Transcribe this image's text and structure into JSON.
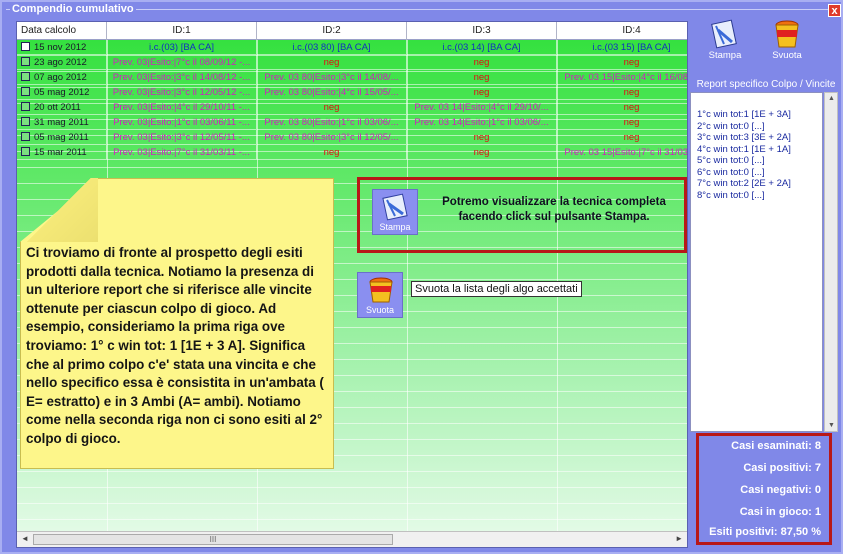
{
  "window": {
    "title": "Compendio cumulativo",
    "close_label": "x"
  },
  "grid": {
    "columns": [
      "Data calcolo",
      "ID:1",
      "ID:2",
      "ID:3",
      "ID:4"
    ],
    "rows": [
      {
        "date": "15 nov 2012",
        "selected": true,
        "cells": [
          {
            "text": "i.c.(03) [BA CA]",
            "color": "blue"
          },
          {
            "text": "i.c.(03 80) [BA CA]",
            "color": "blue"
          },
          {
            "text": "i.c.(03 14) [BA CA]",
            "color": "blue"
          },
          {
            "text": "i.c.(03 15) [BA CA]",
            "color": "blue"
          }
        ]
      },
      {
        "date": "23 ago 2012",
        "selected": false,
        "cells": [
          {
            "text": "Prev. 03|Esito:|7°c il 08/09/12 -...",
            "color": "mag"
          },
          {
            "text": "neg",
            "color": "red"
          },
          {
            "text": "neg",
            "color": "red"
          },
          {
            "text": "neg",
            "color": "red"
          }
        ]
      },
      {
        "date": "07 ago 2012",
        "selected": false,
        "cells": [
          {
            "text": "Prev. 03|Esito:|3°c il 14/08/12 -...",
            "color": "mag"
          },
          {
            "text": "Prev. 03 80|Esito:|3°c il 14/08/...",
            "color": "mag"
          },
          {
            "text": "neg",
            "color": "red"
          },
          {
            "text": "Prev. 03 15|Esito:|4°c il 16/08/...",
            "color": "mag"
          }
        ]
      },
      {
        "date": "05 mag 2012",
        "selected": false,
        "cells": [
          {
            "text": "Prev. 03|Esito:|3°c il 12/05/12 -...",
            "color": "mag"
          },
          {
            "text": "Prev. 03 80|Esito:|4°c il 15/05/...",
            "color": "mag"
          },
          {
            "text": "neg",
            "color": "red"
          },
          {
            "text": "neg",
            "color": "red"
          }
        ]
      },
      {
        "date": "20 ott 2011",
        "selected": false,
        "cells": [
          {
            "text": "Prev. 03|Esito:|4°c il 29/10/11 -...",
            "color": "mag"
          },
          {
            "text": "neg",
            "color": "red"
          },
          {
            "text": "Prev. 03 14|Esito:|4°c il 29/10/...",
            "color": "mag"
          },
          {
            "text": "neg",
            "color": "red"
          }
        ]
      },
      {
        "date": "31 mag 2011",
        "selected": false,
        "cells": [
          {
            "text": "Prev. 03|Esito:|1°c il 03/06/11 -...",
            "color": "mag"
          },
          {
            "text": "Prev. 03 80|Esito:|1°c il 03/06/...",
            "color": "mag"
          },
          {
            "text": "Prev. 03 14|Esito:|1°c il 03/06/...",
            "color": "mag"
          },
          {
            "text": "neg",
            "color": "red"
          }
        ]
      },
      {
        "date": "05 mag 2011",
        "selected": false,
        "cells": [
          {
            "text": "Prev. 03|Esito:|3°c il 12/05/11 -...",
            "color": "mag"
          },
          {
            "text": "Prev. 03 80|Esito:|3°c il 12/05/...",
            "color": "mag"
          },
          {
            "text": "neg",
            "color": "red"
          },
          {
            "text": "neg",
            "color": "red"
          }
        ]
      },
      {
        "date": "15 mar 2011",
        "selected": false,
        "cells": [
          {
            "text": "Prev. 03|Esito:|7°c il 31/03/11 -...",
            "color": "mag"
          },
          {
            "text": "neg",
            "color": "red"
          },
          {
            "text": "neg",
            "color": "red"
          },
          {
            "text": "Prev. 03 15|Esito:|7°c il 31/03/...",
            "color": "mag"
          }
        ]
      }
    ],
    "scroll_left": "◄",
    "scroll_right": "►",
    "scroll_thumb": "III"
  },
  "note": {
    "text": "Ci troviamo di fronte al prospetto degli esiti prodotti dalla tecnica. Notiamo la presenza di un ulteriore report che si riferisce alle vincite ottenute per ciascun colpo di gioco. Ad esempio, consideriamo la prima riga ove troviamo: 1° c win tot: 1 [1E + 3 A]. Significa che al primo colpo c'e' stata una vincita e che nello specifico essa è consistita in un'ambata ( E= estratto) e in 3 Ambi (A= ambi). Notiamo come nella seconda riga non ci sono esiti al 2° colpo di gioco."
  },
  "callout": {
    "text": "Potremo visualizzare la tecnica completa facendo click sul pulsante Stampa.",
    "stampa_label": "Stampa",
    "svuota_label": "Svuota",
    "tooltip": "Svuota la lista degli algo accettati"
  },
  "toolbar": {
    "stampa_label": "Stampa",
    "svuota_label": "Svuota"
  },
  "report": {
    "title": "Report specifico Colpo / Vincite",
    "items": [
      "1°c win tot:1 [1E + 3A]",
      "2°c win tot:0 [...]",
      "3°c win tot:3 [3E + 2A]",
      "4°c win tot:1 [1E + 1A]",
      "5°c win tot:0 [...]",
      "6°c win tot:0 [...]",
      "7°c win tot:2 [2E + 2A]",
      "8°c win tot:0 [...]"
    ],
    "scroll_up": "▲",
    "scroll_down": "▼"
  },
  "stats": {
    "esaminati": "Casi esaminati: 8",
    "positivi": "Casi positivi: 7",
    "negativi": "Casi negativi: 0",
    "in_gioco": "Casi in gioco: 1",
    "esiti": "Esiti positivi: 87,50 %"
  },
  "colors": {
    "blue": "#1030c0",
    "red": "#e01010",
    "mag": "#d020c0",
    "accent": "#b81818"
  }
}
